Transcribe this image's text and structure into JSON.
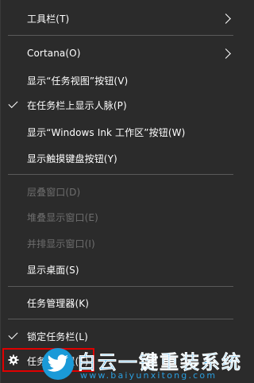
{
  "menu": {
    "toolbars": "工具栏(T)",
    "cortana": "Cortana(O)",
    "show_task_view": "显示“任务视图”按钮(V)",
    "show_people": "在任务栏上显示人脉(P)",
    "show_ink": "显示“Windows Ink 工作区”按钮(W)",
    "show_touch_keyboard": "显示触摸键盘按钮(Y)",
    "cascade": "层叠窗口(D)",
    "stacked": "堆叠显示窗口(E)",
    "side_by_side": "并排显示窗口(I)",
    "show_desktop": "显示桌面(S)",
    "task_manager": "任务管理器(K)",
    "lock_taskbar": "锁定任务栏(L)",
    "taskbar_settings": "任务栏设置(T)"
  },
  "watermark": {
    "title": "白云一键重装系统",
    "url": "www.baiyunxitong.com",
    "color": "#2a9fe0"
  },
  "colors": {
    "menu_bg": "#2b2b2b",
    "text": "#ffffff",
    "disabled_text": "#6e6e6e",
    "separator": "#5a5a5a",
    "highlight_box": "#e00000"
  }
}
